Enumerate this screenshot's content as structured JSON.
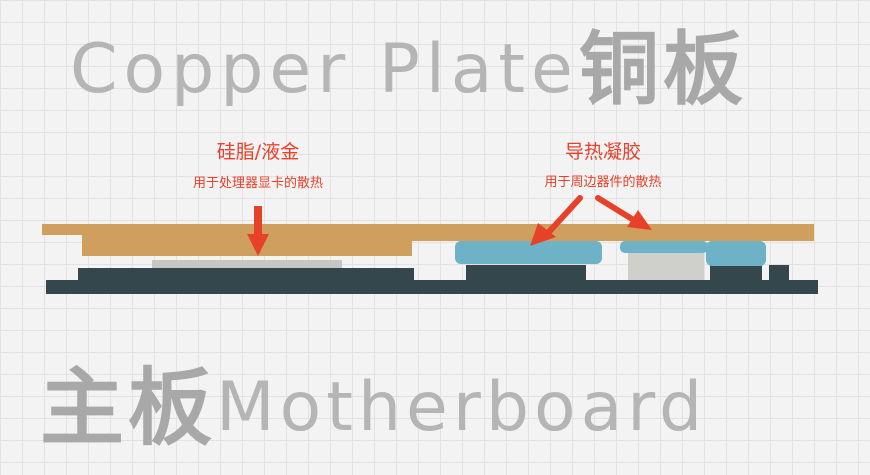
{
  "titles": {
    "top_latin": "Copper Plate",
    "top_cjk": "铜板",
    "bottom_cjk": "主板",
    "bottom_latin": "Motherboard"
  },
  "labels": {
    "left_main": "硅脂/液金",
    "left_sub": "用于处理器显卡的散热",
    "right_main": "导热凝胶",
    "right_sub": "用于周边器件的散热"
  },
  "colors": {
    "copper": "#cf9f5e",
    "board": "#33474c",
    "chip": "#c6c6c3",
    "pad": "#6eb2c8",
    "component": "#cfcfcb",
    "arrow": "#e8412a"
  }
}
